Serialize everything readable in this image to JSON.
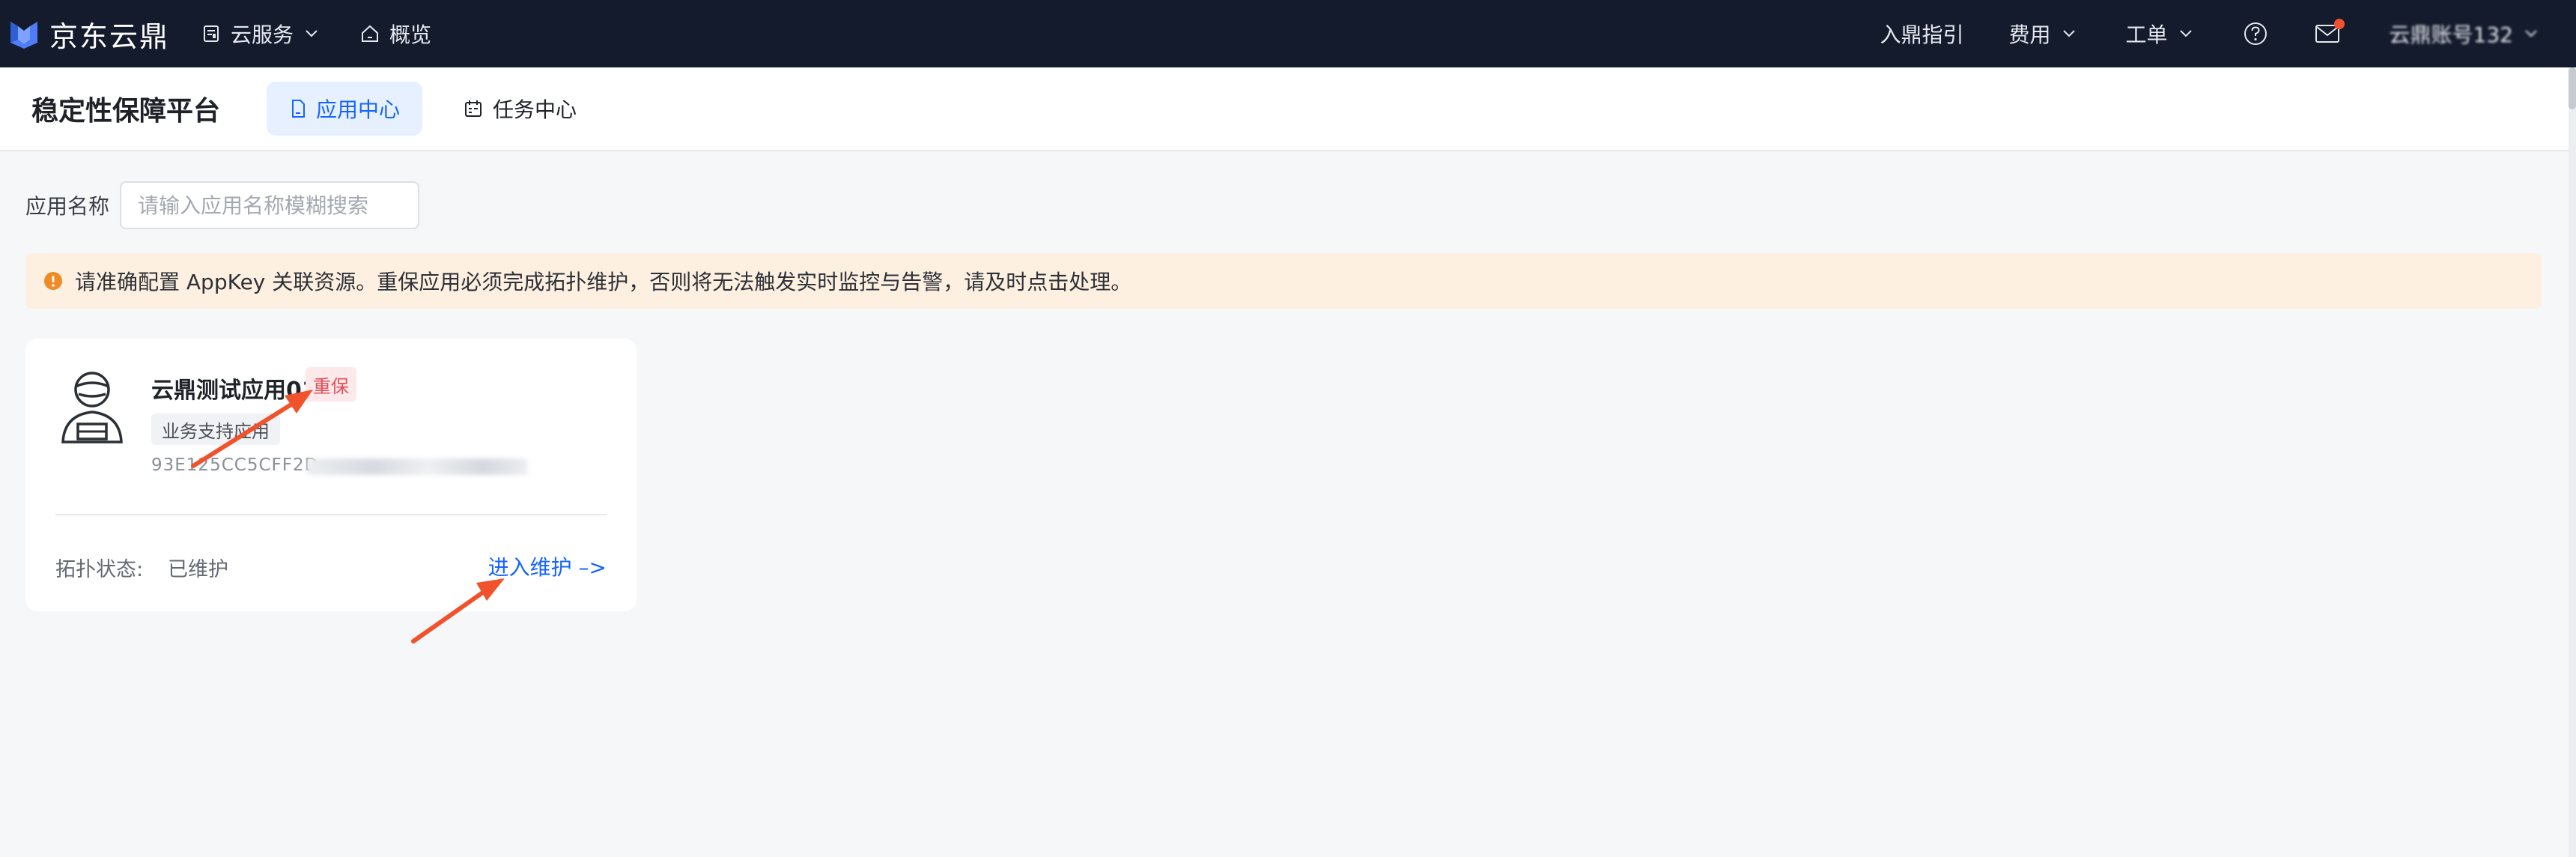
{
  "topnav": {
    "brand": "京东云鼎",
    "cloud_services": "云服务",
    "overview": "概览",
    "guide": "入鼎指引",
    "fees": "费用",
    "tickets": "工单",
    "account": "云鼎账号132",
    "has_unread_mail": true
  },
  "subheader": {
    "title": "稳定性保障平台",
    "tabs": [
      {
        "label": "应用中心",
        "active": true
      },
      {
        "label": "任务中心",
        "active": false
      }
    ]
  },
  "search": {
    "label": "应用名称",
    "placeholder": "请输入应用名称模糊搜索",
    "value": ""
  },
  "alert": {
    "text": "请准确配置 AppKey 关联资源。重保应用必须完成拓扑维护，否则将无法触发实时监控与告警，请及时点击处理。"
  },
  "apps": [
    {
      "name": "云鼎测试应用01",
      "badge": "重保",
      "type": "业务支持应用",
      "appkey_visible": "93E125CC5CFF2D",
      "status_label": "拓扑状态:",
      "status_value": "已维护",
      "action": "进入维护 –>"
    }
  ],
  "colors": {
    "nav_bg": "#141b2d",
    "accent": "#1664ff",
    "alert_bg": "#fdf0e1",
    "alert_icon": "#f08a24",
    "badge_bg": "#fde8ea",
    "badge_text": "#e34d59",
    "annotation_arrow": "#f0522c"
  }
}
